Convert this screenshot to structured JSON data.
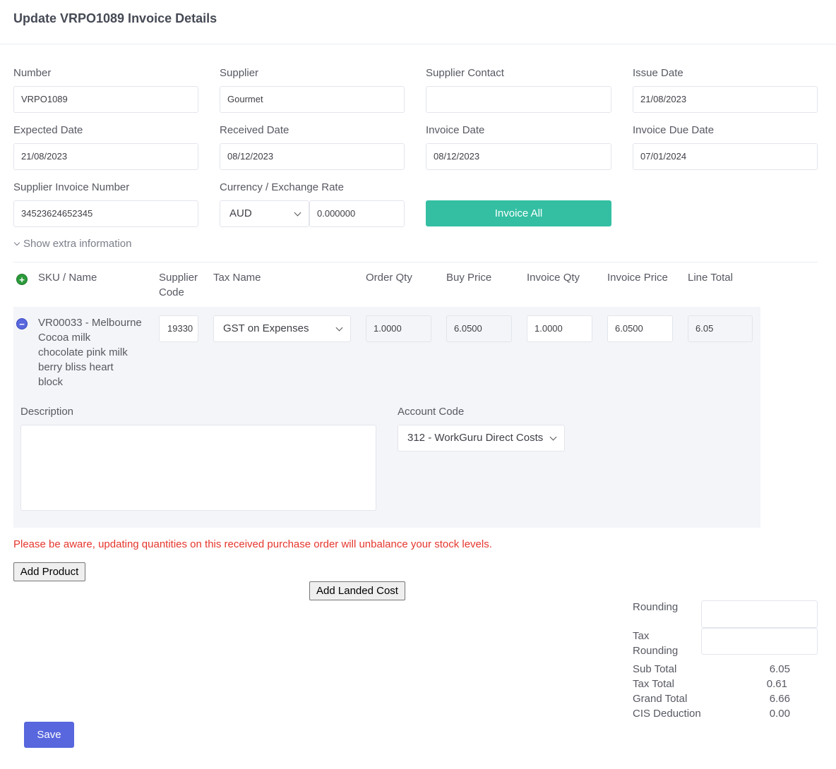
{
  "page": {
    "title": "Update VRPO1089 Invoice Details"
  },
  "fields": {
    "number": {
      "label": "Number",
      "value": "VRPO1089"
    },
    "supplier": {
      "label": "Supplier",
      "value": "Gourmet"
    },
    "supplier_contact": {
      "label": "Supplier Contact",
      "value": ""
    },
    "issue_date": {
      "label": "Issue Date",
      "value": "21/08/2023"
    },
    "expected_date": {
      "label": "Expected Date",
      "value": "21/08/2023"
    },
    "received_date": {
      "label": "Received Date",
      "value": "08/12/2023"
    },
    "invoice_date": {
      "label": "Invoice Date",
      "value": "08/12/2023"
    },
    "invoice_due_date": {
      "label": "Invoice Due Date",
      "value": "07/01/2024"
    },
    "supplier_invoice_number": {
      "label": "Supplier Invoice Number",
      "value": "34523624652345"
    },
    "currency": {
      "label": "Currency / Exchange Rate",
      "currency": "AUD",
      "rate": "0.000000"
    }
  },
  "buttons": {
    "invoice_all": "Invoice All",
    "add_product": "Add Product",
    "add_landed_cost": "Add Landed Cost",
    "save": "Save"
  },
  "extra_info_toggle": "Show extra information",
  "table": {
    "headers": {
      "sku_name": "SKU / Name",
      "supplier_code_1": "Supplier",
      "supplier_code_2": "Code",
      "tax_name": "Tax Name",
      "order_qty": "Order Qty",
      "buy_price": "Buy Price",
      "invoice_qty": "Invoice Qty",
      "invoice_price": "Invoice Price",
      "line_total": "Line Total"
    },
    "add_icon": "+",
    "remove_icon": "−",
    "row": {
      "name_lines": [
        "VR00033 - Melbourne",
        "Cocoa milk",
        "chocolate pink milk",
        "berry bliss heart",
        "block"
      ],
      "supplier_code": "19330",
      "tax_name": "GST on Expenses",
      "order_qty": "1.0000",
      "buy_price": "6.0500",
      "invoice_qty": "1.0000",
      "invoice_price": "6.0500",
      "line_total": "6.05",
      "description_label": "Description",
      "description": "",
      "account_code_label": "Account Code",
      "account_code": "312 - WorkGuru Direct Costs"
    }
  },
  "warning": "Please be aware, updating quantities on this received purchase order will unbalance your stock levels.",
  "totals": {
    "rounding_label": "Rounding",
    "rounding_value": "",
    "tax_rounding_label_1": "Tax",
    "tax_rounding_label_2": "Rounding",
    "tax_rounding_value": "",
    "sub_total_label": "Sub Total",
    "sub_total": "6.05",
    "tax_total_label": "Tax Total",
    "tax_total": "0.61",
    "grand_total_label": "Grand Total",
    "grand_total": "6.66",
    "cis_deduction_label": "CIS Deduction",
    "cis_deduction": "0.00"
  },
  "colors": {
    "primary": "#5867dd",
    "success": "#34bfa3",
    "danger": "#e5362d",
    "add_icon": "#2c9a3b",
    "remove_icon": "#5867dd"
  }
}
